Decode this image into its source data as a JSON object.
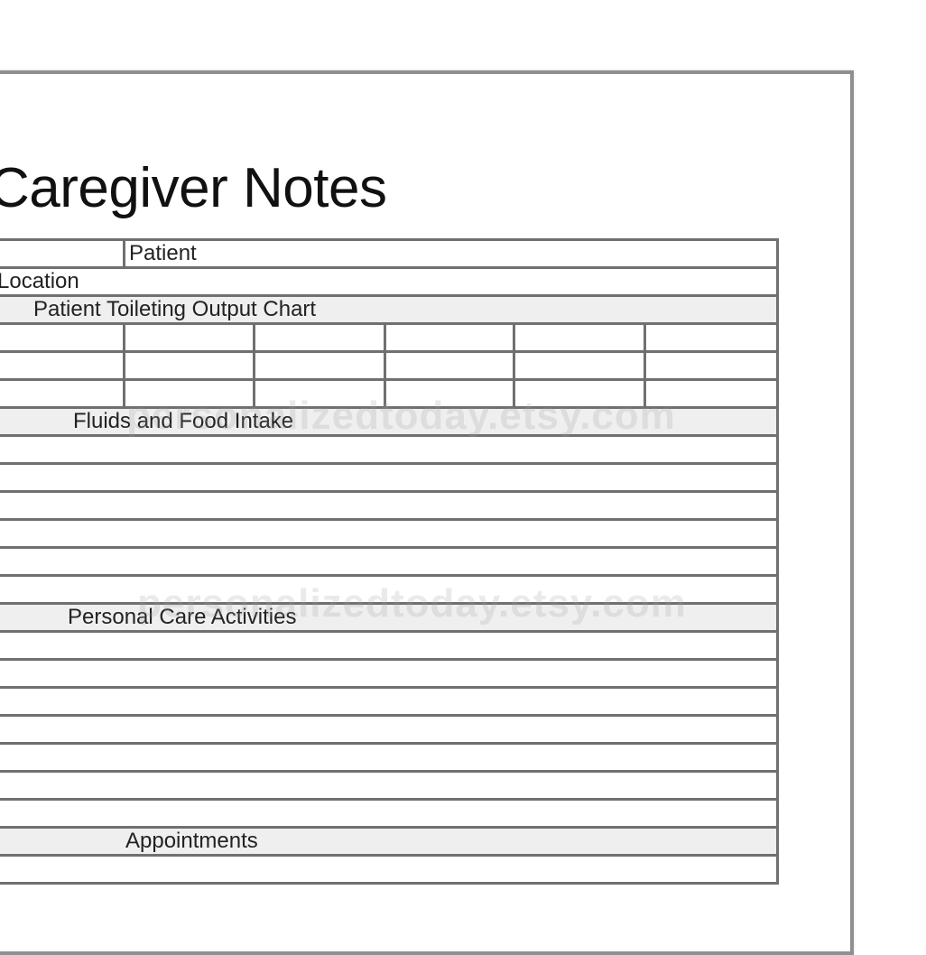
{
  "document": {
    "title": "Caregiver Notes",
    "fields": {
      "patient_label": "Patient",
      "location_label": "Location"
    },
    "sections": {
      "toileting": "Patient Toileting Output Chart",
      "fluids": "Fluids and Food Intake",
      "personal_care": "Personal Care Activities",
      "appointments": "Appointments"
    },
    "watermark": "personalizedtoday.etsy.com"
  }
}
